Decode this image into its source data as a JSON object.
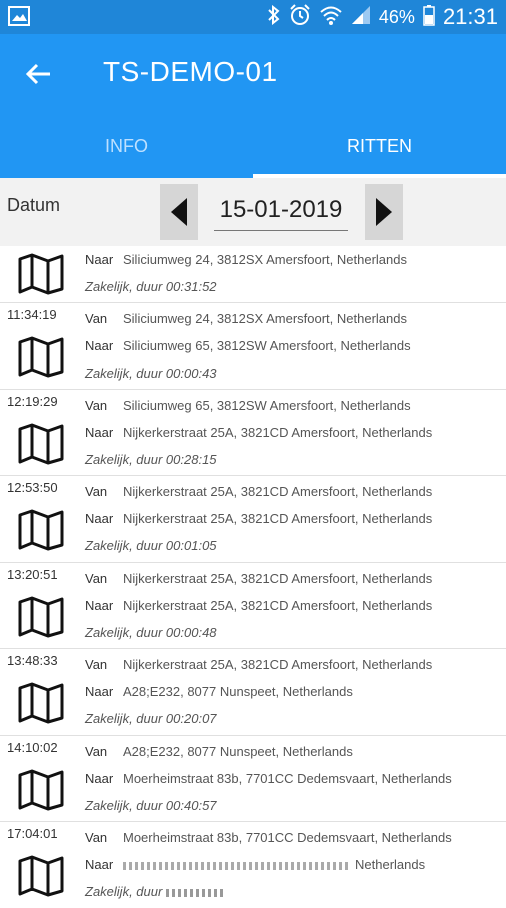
{
  "status_bar": {
    "battery": "46%",
    "time": "21:31",
    "icons": [
      "image-icon",
      "bluetooth-icon",
      "alarm-icon",
      "wifi-icon",
      "signal-icon",
      "battery-icon"
    ]
  },
  "app_bar": {
    "title": "TS-DEMO-01",
    "back_icon": "arrow-back-icon"
  },
  "tabs": [
    {
      "label": "INFO",
      "selected": false
    },
    {
      "label": "RITTEN",
      "selected": true
    }
  ],
  "date_filter": {
    "label": "Datum",
    "value": "15-01-2019"
  },
  "colors": {
    "primary": "#2196f3",
    "status_bar": "#1f86d8",
    "indicator": "#ffffff"
  },
  "trips": [
    {
      "time": "",
      "van": "",
      "naar": "Siliciumweg 24, 3812SX Amersfoort, Netherlands",
      "info": "Zakelijk, duur 00:31:52"
    },
    {
      "time": "11:34:19",
      "van": "Siliciumweg 24, 3812SX Amersfoort, Netherlands",
      "naar": "Siliciumweg 65, 3812SW Amersfoort, Netherlands",
      "info": "Zakelijk, duur 00:00:43"
    },
    {
      "time": "12:19:29",
      "van": "Siliciumweg 65, 3812SW Amersfoort, Netherlands",
      "naar": "Nijkerkerstraat 25A, 3821CD Amersfoort, Netherlands",
      "info": "Zakelijk, duur 00:28:15"
    },
    {
      "time": "12:53:50",
      "van": "Nijkerkerstraat 25A, 3821CD Amersfoort, Netherlands",
      "naar": "Nijkerkerstraat 25A, 3821CD Amersfoort, Netherlands",
      "info": "Zakelijk, duur 00:01:05"
    },
    {
      "time": "13:20:51",
      "van": "Nijkerkerstraat 25A, 3821CD Amersfoort, Netherlands",
      "naar": "Nijkerkerstraat 25A, 3821CD Amersfoort, Netherlands",
      "info": "Zakelijk, duur 00:00:48"
    },
    {
      "time": "13:48:33",
      "van": "Nijkerkerstraat 25A, 3821CD Amersfoort, Netherlands",
      "naar": "A28;E232, 8077 Nunspeet, Netherlands",
      "info": "Zakelijk, duur 00:20:07"
    },
    {
      "time": "14:10:02",
      "van": "A28;E232, 8077 Nunspeet, Netherlands",
      "naar": "Moerheimstraat 83b, 7701CC Dedemsvaart, Netherlands",
      "info": "Zakelijk, duur 00:40:57"
    },
    {
      "time": "17:04:01",
      "van": "Moerheimstraat 83b, 7701CC Dedemsvaart, Netherlands",
      "naar": "Netherlands",
      "info": "Zakelijk, duur"
    }
  ],
  "labels": {
    "van": "Van",
    "naar": "Naar"
  }
}
